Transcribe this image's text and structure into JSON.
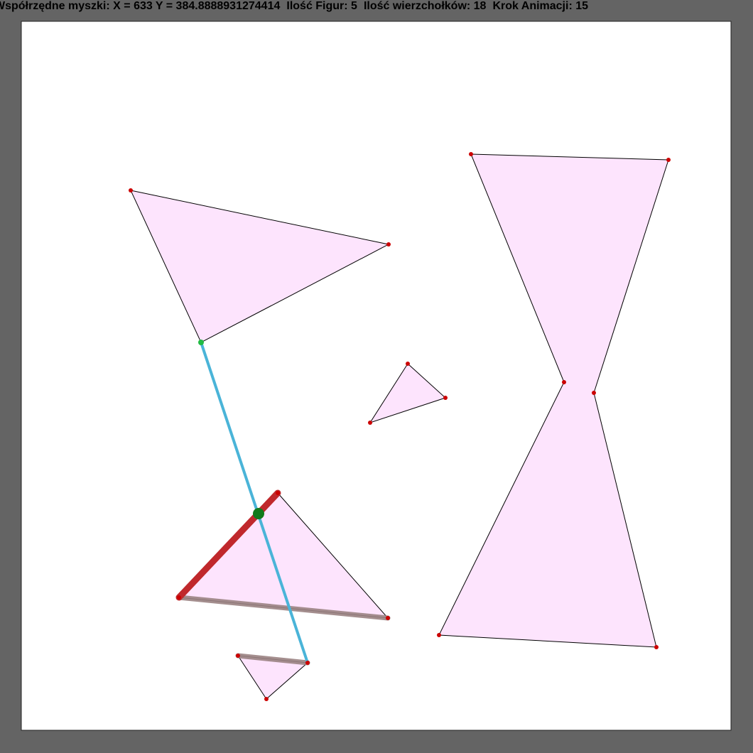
{
  "status": {
    "mouse_label": "Współrzędne myszki: X = ",
    "mouse_x": "633",
    "y_label": " Y = ",
    "mouse_y": "384.8888931274414",
    "figures_label": "Ilość Figur: ",
    "figures_count": "5",
    "vertices_label": "Ilość wierzchołków: ",
    "vertices_count": "18",
    "anim_label": "Krok Animacji: ",
    "anim_step": "15"
  },
  "colors": {
    "window_bg": "#646464",
    "canvas_bg": "#ffffff",
    "polygon_fill": "#fde4fd",
    "vertex": "#cc0000",
    "ray": "#4ab4d8",
    "active_edge": "#c0282c",
    "checked_edge": "#9a8282",
    "intersection": "#117a1a",
    "ray_start": "#22bb44"
  },
  "scene": {
    "polygons": [
      {
        "name": "triangle-top-left",
        "points": [
          [
            184,
            268
          ],
          [
            547,
            344
          ],
          [
            283,
            482
          ]
        ]
      },
      {
        "name": "triangle-small-center",
        "points": [
          [
            574,
            512
          ],
          [
            627,
            560
          ],
          [
            521,
            595
          ]
        ]
      },
      {
        "name": "hourglass-right",
        "points": [
          [
            663,
            217
          ],
          [
            941,
            225
          ],
          [
            836,
            553
          ],
          [
            924,
            911
          ],
          [
            618,
            894
          ],
          [
            794,
            538
          ]
        ]
      },
      {
        "name": "triangle-bottom-center",
        "points": [
          [
            391,
            694
          ],
          [
            546,
            870
          ],
          [
            252,
            841
          ]
        ]
      },
      {
        "name": "triangle-bottom-small",
        "points": [
          [
            335,
            923
          ],
          [
            433,
            933
          ],
          [
            375,
            984
          ]
        ]
      }
    ],
    "ray": {
      "from": [
        283,
        482
      ],
      "to": [
        433,
        933
      ]
    },
    "checked_edges": [
      {
        "from": [
          252,
          841
        ],
        "to": [
          546,
          870
        ]
      },
      {
        "from": [
          335,
          923
        ],
        "to": [
          433,
          933
        ]
      }
    ],
    "active_edge": {
      "from": [
        252,
        841
      ],
      "to": [
        391,
        694
      ]
    },
    "intersection": [
      364,
      723
    ]
  }
}
